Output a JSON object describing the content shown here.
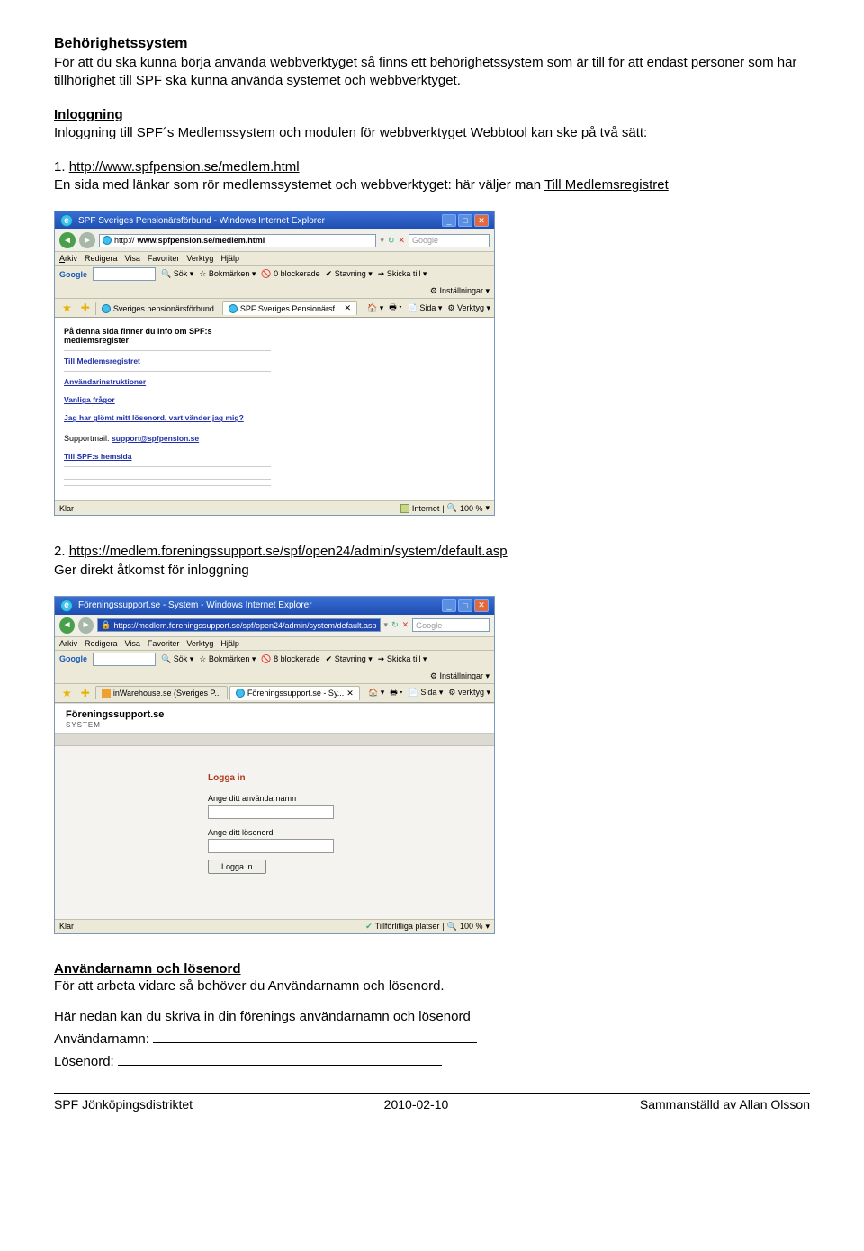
{
  "sec1": {
    "title": "Behörighetssystem",
    "body": "För att du ska kunna börja använda webbverktyget så finns ett behörighetssystem som är till för att endast personer som har tillhörighet till SPF ska kunna använda systemet och webbverktyget."
  },
  "sec2": {
    "title": "Inloggning",
    "body": "Inloggning till SPF´s Medlemssystem och modulen för webbverktyget Webbtool kan ske på två sätt:"
  },
  "opt1": {
    "num": "1. ",
    "url": "http://www.spfpension.se/medlem.html",
    "desc_a": "En sida med länkar som rör medlemssystemet och webbverktyget: här väljer man ",
    "desc_b": "Till Medlemsregistret"
  },
  "shot1": {
    "window_title": "SPF Sveriges Pensionärsförbund - Windows Internet Explorer",
    "address_prefix": "http://",
    "address": "www.spfpension.se/medlem.html",
    "search_hint": "Google",
    "menus": {
      "arkiv": "Arkiv",
      "redigera": "Redigera",
      "visa": "Visa",
      "favoriter": "Favoriter",
      "verktyg": "Verktyg",
      "hjalp": "Hjälp"
    },
    "google_label": "Google",
    "sok": "Sök",
    "bokmarken": "Bokmärken",
    "blockerade": "0 blockerade",
    "stavning": "Stavning",
    "skicka": "Skicka till",
    "installningar": "Inställningar",
    "tab1": "Sveriges pensionärsförbund",
    "tab2": "SPF Sveriges Pensionärsf...",
    "tool_sida": "Sida",
    "tool_verktyg": "Verktyg",
    "panel_head1": "På denna sida finner du info om SPF:s",
    "panel_head2": "medlemsregister",
    "l1": "Till Medlemsregistret",
    "l2": "Användarinstruktioner",
    "l3": "Vanliga frågor",
    "l4": "Jag har glömt mitt lösenord, vart vänder jag mig?",
    "l5a": "Supportmail: ",
    "l5b": "support@spfpension.se",
    "l6": "Till SPF:s hemsida",
    "status_done": "Klar",
    "status_zone": "Internet",
    "status_zoom": "100 %"
  },
  "opt2": {
    "num": "2. ",
    "url": "https://medlem.foreningssupport.se/spf/open24/admin/system/default.asp",
    "desc": "Ger direkt åtkomst för inloggning"
  },
  "shot2": {
    "window_title": "Föreningssupport.se - System - Windows Internet Explorer",
    "address": "https://medlem.foreningssupport.se/spf/open24/admin/system/default.asp",
    "search_hint": "Google",
    "menus": {
      "arkiv": "Arkiv",
      "redigera": "Redigera",
      "visa": "Visa",
      "favoriter": "Favoriter",
      "verktyg": "Verktyg",
      "hjalp": "Hjälp"
    },
    "google_label": "Google",
    "sok": "Sök",
    "bokmarken": "Bokmärken",
    "blockerade": "8 blockerade",
    "stavning": "Stavning",
    "skicka": "Skicka till",
    "installningar": "Inställningar",
    "tab1": "inWarehouse.se (Sveriges P...",
    "tab2": "Föreningssupport.se - Sy...",
    "tool_sida": "Sida",
    "tool_verktyg": "verktyg",
    "brand": "Föreningssupport.se",
    "brand_sub": "SYSTEM",
    "login_title": "Logga in",
    "login_user": "Ange ditt användarnamn",
    "login_pass": "Ange ditt lösenord",
    "login_btn": "Logga in",
    "status_done": "Klar",
    "status_zone": "Tillförlitliga platser",
    "status_zoom": "100 %"
  },
  "sec3": {
    "title": "Användarnamn och lösenord",
    "body": "För att arbeta vidare så behöver du Användarnamn och lösenord.",
    "body2": "Här nedan kan du skriva in din förenings användarnamn och lösenord",
    "user_label": "Användarnamn:",
    "pass_label": "Lösenord:"
  },
  "footer": {
    "left": "SPF Jönköpingsdistriktet",
    "center": "2010-02-10",
    "right": "Sammanställd av Allan Olsson"
  }
}
